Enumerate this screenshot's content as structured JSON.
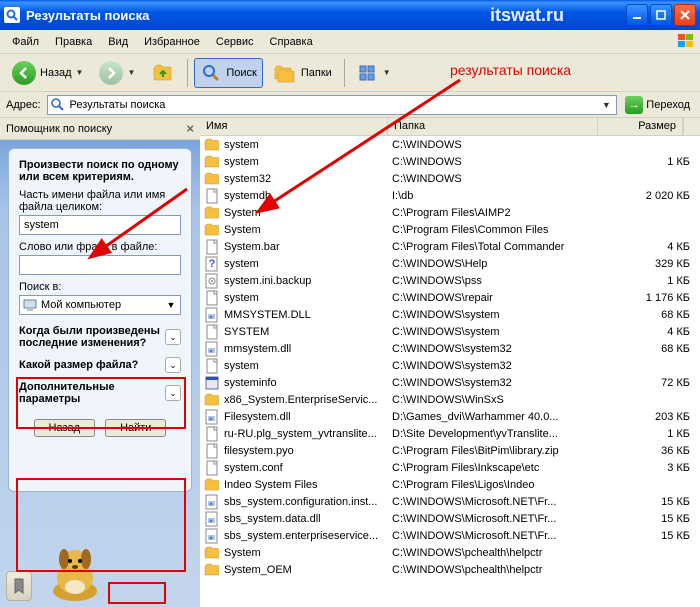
{
  "titlebar": {
    "title": "Результаты поиска",
    "watermark": "itswat.ru"
  },
  "menubar": {
    "items": [
      "Файл",
      "Правка",
      "Вид",
      "Избранное",
      "Сервис",
      "Справка"
    ]
  },
  "toolbar": {
    "back": "Назад",
    "search": "Поиск",
    "folders": "Папки"
  },
  "annotation": {
    "label": "результаты поиска"
  },
  "addrbar": {
    "label": "Адрес:",
    "value": "Результаты поиска",
    "go": "Переход"
  },
  "sidebar": {
    "header": "Помощник по поиску",
    "criteria_title": "Произвести поиск по одному или всем критериям.",
    "filename_label": "Часть имени файла или имя файла целиком:",
    "filename_value": "system",
    "phrase_label": "Слово или фраза в файле:",
    "phrase_value": "",
    "lookin_label": "Поиск в:",
    "lookin_value": "Мой компьютер",
    "expand_when": "Когда были произведены последние изменения?",
    "expand_size": "Какой размер файла?",
    "expand_more": "Дополнительные параметры",
    "btn_back": "Назад",
    "btn_find": "Найти"
  },
  "columns": {
    "name": "Имя",
    "path": "Папка",
    "size": "Размер"
  },
  "files": [
    {
      "icon": "folder",
      "name": "system",
      "path": "C:\\WINDOWS",
      "size": ""
    },
    {
      "icon": "folder",
      "name": "system",
      "path": "C:\\WINDOWS",
      "size": "1 КБ"
    },
    {
      "icon": "folder",
      "name": "system32",
      "path": "C:\\WINDOWS",
      "size": ""
    },
    {
      "icon": "file",
      "name": "systemdb",
      "path": "I:\\db",
      "size": "2 020 КБ"
    },
    {
      "icon": "folder",
      "name": "System",
      "path": "C:\\Program Files\\AIMP2",
      "size": ""
    },
    {
      "icon": "folder",
      "name": "System",
      "path": "C:\\Program Files\\Common Files",
      "size": ""
    },
    {
      "icon": "file",
      "name": "System.bar",
      "path": "C:\\Program Files\\Total Commander",
      "size": "4 КБ"
    },
    {
      "icon": "chm",
      "name": "system",
      "path": "C:\\WINDOWS\\Help",
      "size": "329 КБ"
    },
    {
      "icon": "ini",
      "name": "system.ini.backup",
      "path": "C:\\WINDOWS\\pss",
      "size": "1 КБ"
    },
    {
      "icon": "file",
      "name": "system",
      "path": "C:\\WINDOWS\\repair",
      "size": "1 176 КБ"
    },
    {
      "icon": "dll",
      "name": "MMSYSTEM.DLL",
      "path": "C:\\WINDOWS\\system",
      "size": "68 КБ"
    },
    {
      "icon": "file",
      "name": "SYSTEM",
      "path": "C:\\WINDOWS\\system",
      "size": "4 КБ"
    },
    {
      "icon": "dll",
      "name": "mmsystem.dll",
      "path": "C:\\WINDOWS\\system32",
      "size": "68 КБ"
    },
    {
      "icon": "file",
      "name": "system",
      "path": "C:\\WINDOWS\\system32",
      "size": ""
    },
    {
      "icon": "exe",
      "name": "systeminfo",
      "path": "C:\\WINDOWS\\system32",
      "size": "72 КБ"
    },
    {
      "icon": "folder",
      "name": "x86_System.EnterpriseServic...",
      "path": "C:\\WINDOWS\\WinSxS",
      "size": ""
    },
    {
      "icon": "dll",
      "name": "Filesystem.dll",
      "path": "D:\\Games_dvi\\Warhammer 40.0...",
      "size": "203 КБ"
    },
    {
      "icon": "file",
      "name": "ru-RU.plg_system_yvtranslite...",
      "path": "D:\\Site Development\\yvTranslite...",
      "size": "1 КБ"
    },
    {
      "icon": "file",
      "name": "filesystem.pyo",
      "path": "C:\\Program Files\\BitPim\\library.zip",
      "size": "36 КБ"
    },
    {
      "icon": "file",
      "name": "system.conf",
      "path": "C:\\Program Files\\Inkscape\\etc",
      "size": "3 КБ"
    },
    {
      "icon": "folder",
      "name": "Indeo System Files",
      "path": "C:\\Program Files\\Ligos\\Indeo",
      "size": ""
    },
    {
      "icon": "dll",
      "name": "sbs_system.configuration.inst...",
      "path": "C:\\WINDOWS\\Microsoft.NET\\Fr...",
      "size": "15 КБ"
    },
    {
      "icon": "dll",
      "name": "sbs_system.data.dll",
      "path": "C:\\WINDOWS\\Microsoft.NET\\Fr...",
      "size": "15 КБ"
    },
    {
      "icon": "dll",
      "name": "sbs_system.enterpriseservice...",
      "path": "C:\\WINDOWS\\Microsoft.NET\\Fr...",
      "size": "15 КБ"
    },
    {
      "icon": "folder",
      "name": "System",
      "path": "C:\\WINDOWS\\pchealth\\helpctr",
      "size": ""
    },
    {
      "icon": "folder",
      "name": "System_OEM",
      "path": "C:\\WINDOWS\\pchealth\\helpctr",
      "size": ""
    }
  ]
}
